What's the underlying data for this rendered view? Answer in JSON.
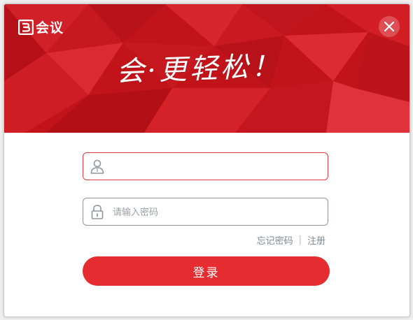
{
  "app": {
    "logo_text": "会议",
    "slogan": "会·更轻松！"
  },
  "form": {
    "username_placeholder": "",
    "password_placeholder": "请输入密码",
    "forgot_password": "忘记密码",
    "separator": "|",
    "register": "注册",
    "login_label": "登录"
  },
  "colors": {
    "brand_red": "#c8141b",
    "button_red": "#e52d31",
    "active_border": "#e43a3f",
    "link_gray": "#7d8a96"
  }
}
